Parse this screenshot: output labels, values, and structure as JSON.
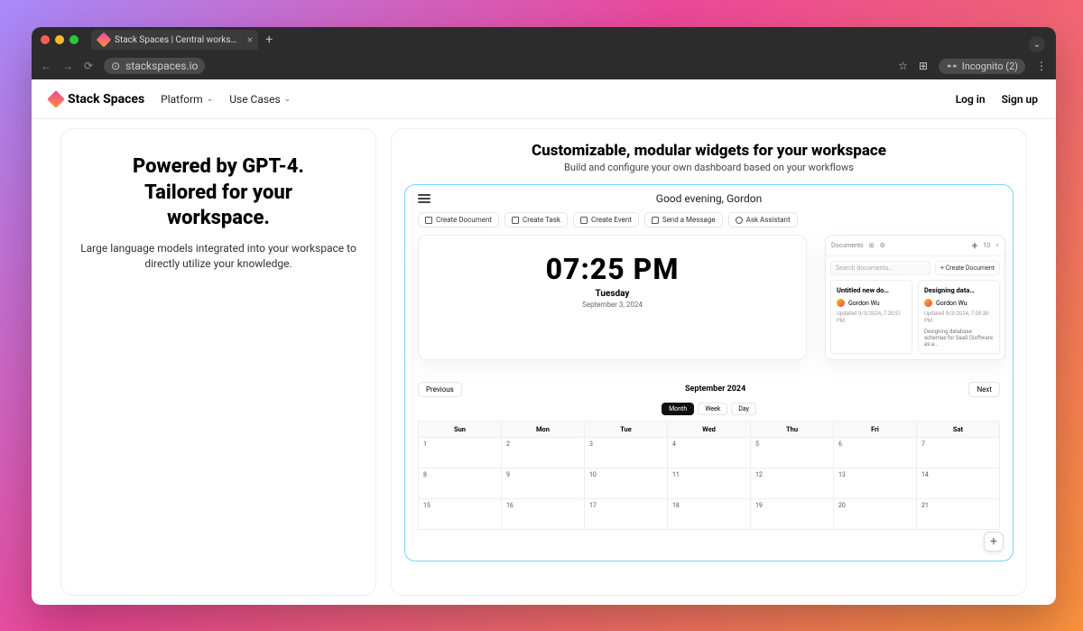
{
  "browser": {
    "tab_title": "Stack Spaces | Central works…",
    "url_host": "stackspaces.io",
    "incognito_label": "Incognito (2)"
  },
  "header": {
    "brand": "Stack Spaces",
    "nav": {
      "platform": "Platform",
      "usecases": "Use Cases"
    },
    "login": "Log in",
    "signup": "Sign up"
  },
  "left": {
    "title_l1": "Powered by GPT-4.",
    "title_l2": "Tailored for your",
    "title_l3": "workspace.",
    "subtitle": "Large language models integrated into your workspace to directly utilize your knowledge."
  },
  "right": {
    "title": "Customizable, modular widgets for your workspace",
    "subtitle": "Build and configure your own dashboard based on your workflows"
  },
  "dash": {
    "greeting": "Good evening, Gordon",
    "quick": {
      "create_document": "Create Document",
      "create_task": "Create Task",
      "create_event": "Create Event",
      "send_message": "Send a Message",
      "ask_assistant": "Ask Assistant"
    },
    "clock": {
      "time": "07:25 PM",
      "day": "Tuesday",
      "date": "September 3, 2024"
    },
    "documents": {
      "header_label": "Documents",
      "panel_id": "10",
      "search_placeholder": "Search documents…",
      "create_button": "+ Create Document",
      "cards": [
        {
          "title": "Untitled new do…",
          "author": "Gordon Wu",
          "updated": "Updated 9/3/2024, 7:20:51 PM",
          "desc": ""
        },
        {
          "title": "Designing data…",
          "author": "Gordon Wu",
          "updated": "Updated 9/3/2024, 7:09:30 PM",
          "desc": "Designing database schemas for SaaS (Software as a…"
        }
      ]
    },
    "calendar": {
      "prev_label": "Previous",
      "next_label": "Next",
      "title": "September 2024",
      "tabs": {
        "month": "Month",
        "week": "Week",
        "day": "Day"
      },
      "dow": [
        "Sun",
        "Mon",
        "Tue",
        "Wed",
        "Thu",
        "Fri",
        "Sat"
      ],
      "grid": [
        [
          "1",
          "2",
          "3",
          "4",
          "5",
          "6",
          "7"
        ],
        [
          "8",
          "9",
          "10",
          "11",
          "12",
          "13",
          "14"
        ],
        [
          "15",
          "16",
          "17",
          "18",
          "19",
          "20",
          "21"
        ]
      ]
    }
  }
}
